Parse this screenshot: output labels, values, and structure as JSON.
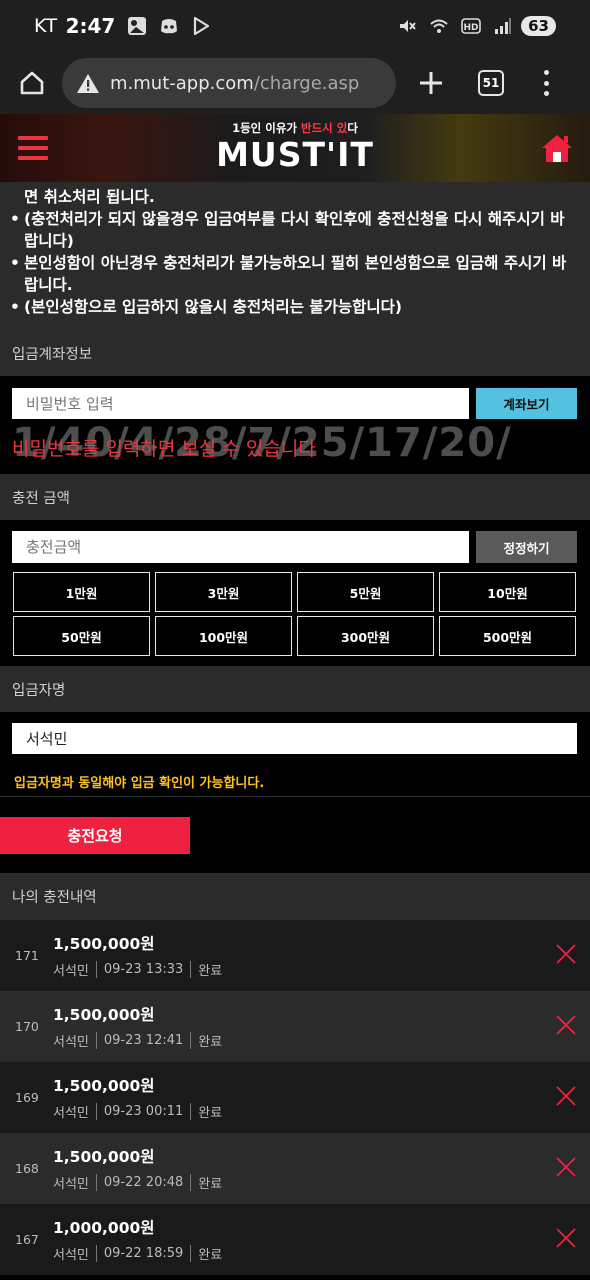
{
  "status_bar": {
    "carrier": "KT",
    "time": "2:47",
    "battery": "63",
    "hd_label": "HD"
  },
  "browser": {
    "url_host": "m.mut-app.com",
    "url_path": "/charge.asp",
    "tab_count": "51"
  },
  "site": {
    "tagline_prefix": "1등인 이유가 ",
    "tagline_highlight": "반드시 있",
    "tagline_suffix": "다",
    "brand": "MUST'IT"
  },
  "notice": {
    "line0": "면 취소처리 됩니다.",
    "items": [
      "(충전처리가 되지 않을경우 입금여부를 다시 확인후에 충전신청을 다시 해주시기 바랍니다)",
      "본인성함이 아닌경우 충전처리가 불가능하오니 필히 본인성함으로 입금해 주시기 바랍니다.",
      "(본인성함으로 입금하지 않을시 충전처리는 불가능합니다)"
    ]
  },
  "account_section": {
    "title": "입금계좌정보",
    "password_placeholder": "비밀번호 입력",
    "view_button": "계좌보기",
    "hint": "비밀번호를 입력하면 보실 수 있습니다",
    "overlay_text": "1/40/4/28/7/25/17/20/"
  },
  "amount_section": {
    "title": "충전 금액",
    "amount_placeholder": "충전금액",
    "reset_button": "정정하기",
    "amounts": [
      "1만원",
      "3만원",
      "5만원",
      "10만원",
      "50만원",
      "100만원",
      "300만원",
      "500만원"
    ]
  },
  "depositor_section": {
    "title": "입금자명",
    "name_value": "서석민",
    "note": "입금자명과 동일해야 입금 확인이 가능합니다.",
    "request_button": "충전요청"
  },
  "history_section": {
    "title": "나의 충전내역",
    "rows": [
      {
        "no": "171",
        "amount": "1,500,000원",
        "name": "서석민",
        "datetime": "09-23 13:33",
        "status": "완료"
      },
      {
        "no": "170",
        "amount": "1,500,000원",
        "name": "서석민",
        "datetime": "09-23 12:41",
        "status": "완료"
      },
      {
        "no": "169",
        "amount": "1,500,000원",
        "name": "서석민",
        "datetime": "09-23 00:11",
        "status": "완료"
      },
      {
        "no": "168",
        "amount": "1,500,000원",
        "name": "서석민",
        "datetime": "09-22 20:48",
        "status": "완료"
      },
      {
        "no": "167",
        "amount": "1,000,000원",
        "name": "서석민",
        "datetime": "09-22 18:59",
        "status": "완료"
      }
    ]
  },
  "colors": {
    "accent_red": "#ee2140",
    "accent_cyan": "#55c1e0",
    "note_yellow": "#ffc21a"
  }
}
